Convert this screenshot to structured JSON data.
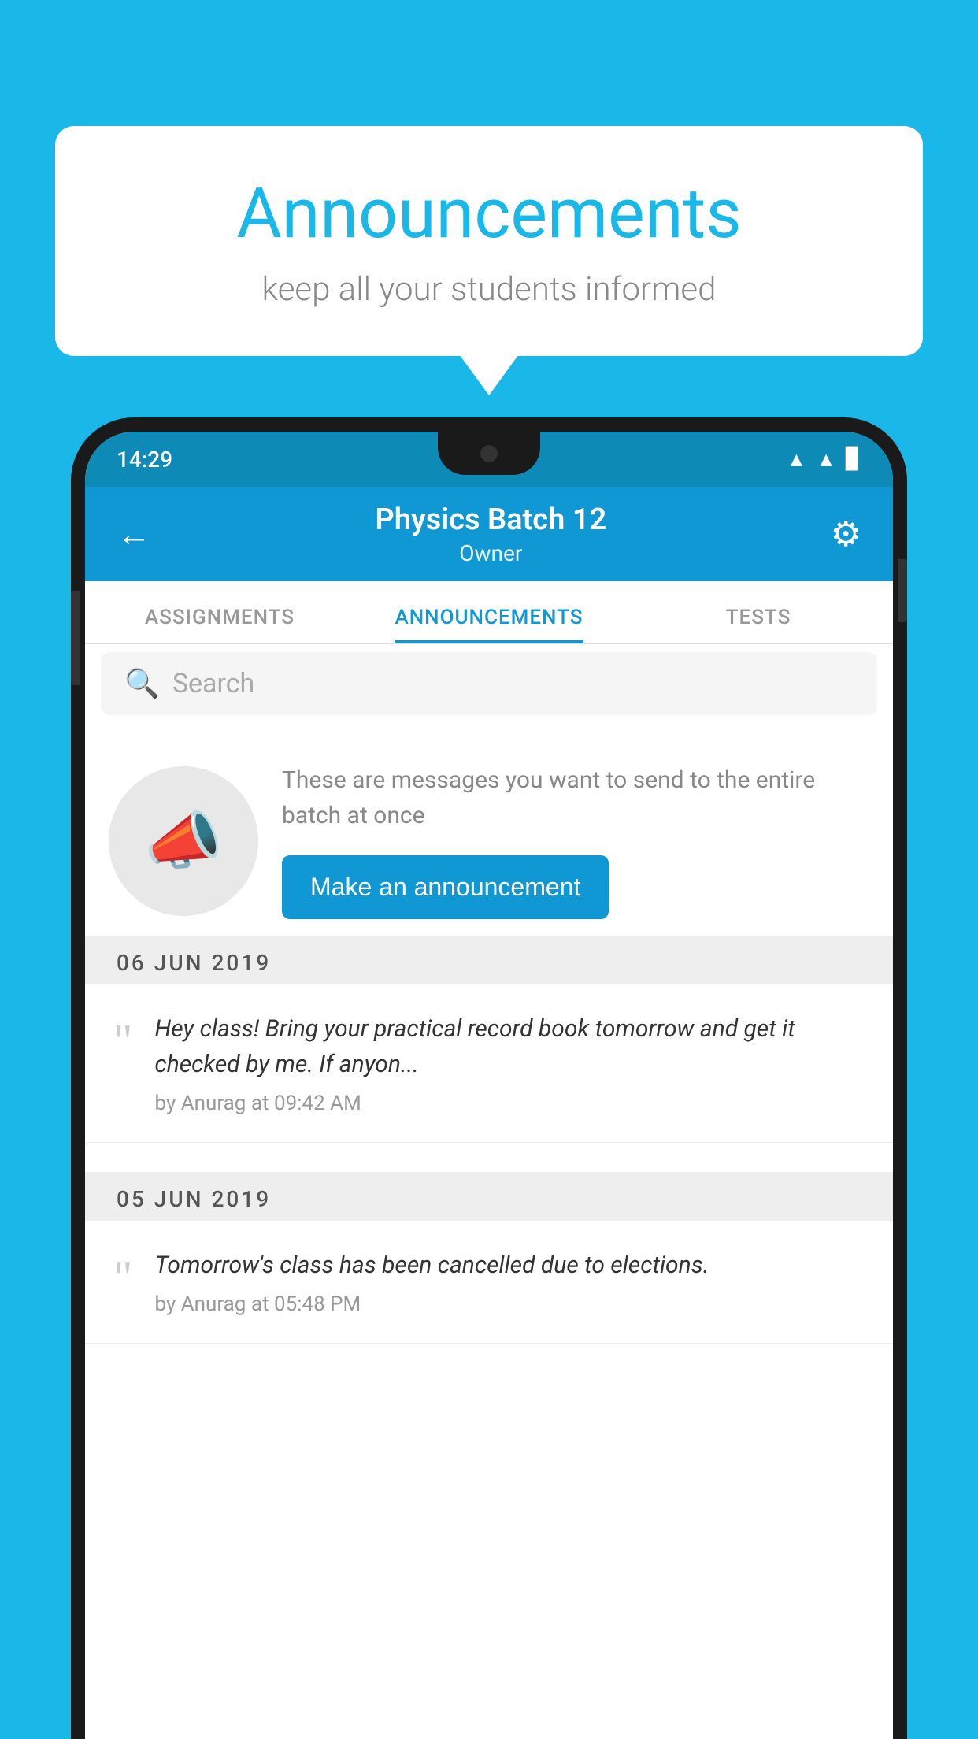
{
  "bubble": {
    "title": "Announcements",
    "subtitle": "keep all your students informed"
  },
  "phone": {
    "status_time": "14:29",
    "header": {
      "batch_name": "Physics Batch 12",
      "role": "Owner",
      "back_label": "←",
      "gear_label": "⚙"
    },
    "tabs": [
      {
        "label": "ASSIGNMENTS",
        "active": false
      },
      {
        "label": "ANNOUNCEMENTS",
        "active": true
      },
      {
        "label": "TESTS",
        "active": false
      }
    ],
    "search": {
      "placeholder": "Search"
    },
    "prompt": {
      "description": "These are messages you want to send to the entire batch at once",
      "button_label": "Make an announcement"
    },
    "date_sections": [
      {
        "label": "06  JUN  2019"
      },
      {
        "label": "05  JUN  2019"
      }
    ],
    "announcements": [
      {
        "text": "Hey class! Bring your practical record book tomorrow and get it checked by me. If anyon...",
        "meta": "by Anurag at 09:42 AM"
      },
      {
        "text": "Tomorrow's class has been cancelled due to elections.",
        "meta": "by Anurag at 05:48 PM"
      }
    ]
  }
}
